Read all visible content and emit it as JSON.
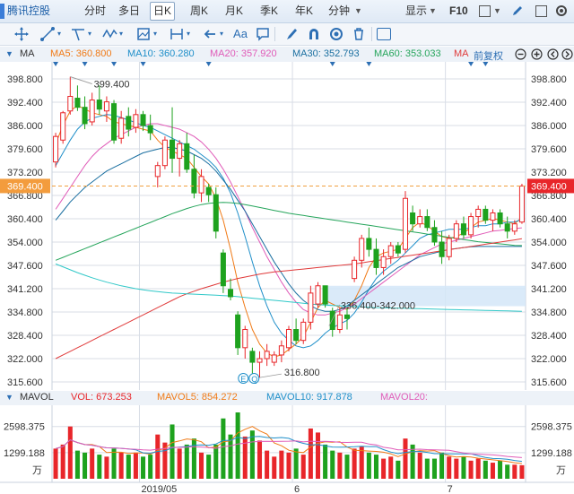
{
  "toolbar": {
    "stock_name": "腾讯控股",
    "periods": [
      "分时",
      "多日",
      "日K",
      "周K",
      "月K",
      "季K",
      "年K",
      "分钟"
    ],
    "active_period": "日K",
    "display_label": "显示",
    "f10_label": "F10"
  },
  "drawing_tools": {
    "text_tool_label": "Aa"
  },
  "ma_legend": {
    "name": "MA",
    "ma5": "MA5: 360.800",
    "ma10": "MA10: 360.280",
    "ma20": "MA20: 357.920",
    "ma30": "MA30: 352.793",
    "ma60": "MA60: 353.033",
    "ma_more": "MA",
    "adjust_label": "前复权"
  },
  "vol_legend": {
    "name": "MAVOL",
    "vol": "VOL: 673.253",
    "mavol5": "MAVOL5: 854.272",
    "mavol10": "MAVOL10: 917.878",
    "mavol20": "MAVOL20:"
  },
  "colors": {
    "up": "#e8262a",
    "down": "#1ea21e",
    "ma5": "#f07a16",
    "ma10": "#1f8fc9",
    "ma20": "#e05bb8",
    "ma30": "#1a6fa0",
    "ma60": "#25a55b",
    "ma120": "#e03a3a",
    "ma250": "#30c8c8",
    "mavol5": "#f07a16",
    "mavol10": "#1f8fc9",
    "mavol20": "#e05bb8",
    "grid": "#d8dde6",
    "dashed_price": "#f0a040"
  },
  "chart_data": {
    "type": "candlestick",
    "y_ticks": [
      "398.800",
      "392.400",
      "386.000",
      "379.600",
      "373.200",
      "366.800",
      "360.400",
      "354.000",
      "347.600",
      "341.200",
      "334.800",
      "328.400",
      "322.000",
      "315.600"
    ],
    "ylim": [
      315.6,
      398.8
    ],
    "x_labels": [
      "2019/05",
      "6",
      "7"
    ],
    "current_price": "369.400",
    "annotations": {
      "high": "399.400",
      "low": "316.800",
      "gap": "336.400-342.000"
    },
    "gap_zone": [
      336.4,
      342.0
    ],
    "candles": [
      {
        "o": 376.0,
        "h": 384.0,
        "l": 374.5,
        "c": 383.0
      },
      {
        "o": 382.0,
        "h": 390.0,
        "l": 381.0,
        "c": 389.5
      },
      {
        "o": 390.0,
        "h": 399.4,
        "l": 389.0,
        "c": 394.0
      },
      {
        "o": 393.5,
        "h": 397.0,
        "l": 390.0,
        "c": 391.0
      },
      {
        "o": 391.0,
        "h": 394.0,
        "l": 385.0,
        "c": 386.5
      },
      {
        "o": 387.0,
        "h": 395.0,
        "l": 386.0,
        "c": 393.0
      },
      {
        "o": 393.0,
        "h": 397.0,
        "l": 389.0,
        "c": 390.5
      },
      {
        "o": 390.0,
        "h": 394.0,
        "l": 387.0,
        "c": 392.5
      },
      {
        "o": 392.0,
        "h": 393.0,
        "l": 381.0,
        "c": 382.0
      },
      {
        "o": 382.5,
        "h": 390.0,
        "l": 381.0,
        "c": 388.0
      },
      {
        "o": 388.5,
        "h": 391.0,
        "l": 383.0,
        "c": 385.0
      },
      {
        "o": 385.5,
        "h": 390.5,
        "l": 384.0,
        "c": 389.0
      },
      {
        "o": 389.0,
        "h": 390.0,
        "l": 384.5,
        "c": 386.0
      },
      {
        "o": 386.0,
        "h": 389.0,
        "l": 382.0,
        "c": 384.0
      },
      {
        "o": 372.0,
        "h": 376.0,
        "l": 369.0,
        "c": 375.0
      },
      {
        "o": 375.0,
        "h": 383.0,
        "l": 374.0,
        "c": 382.0
      },
      {
        "o": 382.0,
        "h": 391.0,
        "l": 373.0,
        "c": 377.0
      },
      {
        "o": 377.0,
        "h": 382.0,
        "l": 372.0,
        "c": 381.0
      },
      {
        "o": 381.0,
        "h": 384.0,
        "l": 373.0,
        "c": 374.0
      },
      {
        "o": 374.0,
        "h": 378.0,
        "l": 366.0,
        "c": 367.5
      },
      {
        "o": 367.5,
        "h": 374.0,
        "l": 365.0,
        "c": 372.0
      },
      {
        "o": 369.0,
        "h": 370.0,
        "l": 365.0,
        "c": 367.0
      },
      {
        "o": 367.0,
        "h": 369.0,
        "l": 355.0,
        "c": 357.0
      },
      {
        "o": 351.0,
        "h": 352.0,
        "l": 340.0,
        "c": 342.0
      },
      {
        "o": 341.0,
        "h": 344.0,
        "l": 338.0,
        "c": 339.0
      },
      {
        "o": 334.0,
        "h": 335.0,
        "l": 323.0,
        "c": 325.0
      },
      {
        "o": 325.0,
        "h": 331.0,
        "l": 322.0,
        "c": 330.0
      },
      {
        "o": 324.0,
        "h": 325.0,
        "l": 317.0,
        "c": 321.0
      },
      {
        "o": 321.0,
        "h": 324.0,
        "l": 316.8,
        "c": 322.0
      },
      {
        "o": 322.0,
        "h": 326.0,
        "l": 320.0,
        "c": 324.0
      },
      {
        "o": 321.0,
        "h": 324.0,
        "l": 320.0,
        "c": 323.0
      },
      {
        "o": 323.0,
        "h": 327.0,
        "l": 321.0,
        "c": 325.5
      },
      {
        "o": 325.0,
        "h": 331.0,
        "l": 324.0,
        "c": 330.0
      },
      {
        "o": 330.0,
        "h": 333.0,
        "l": 326.0,
        "c": 327.0
      },
      {
        "o": 327.0,
        "h": 333.0,
        "l": 326.0,
        "c": 332.0
      },
      {
        "o": 332.0,
        "h": 342.0,
        "l": 330.0,
        "c": 340.0
      },
      {
        "o": 337.0,
        "h": 343.0,
        "l": 336.0,
        "c": 342.0
      },
      {
        "o": 342.0,
        "h": 342.0,
        "l": 336.0,
        "c": 337.0
      },
      {
        "o": 335.0,
        "h": 336.0,
        "l": 328.0,
        "c": 330.0
      },
      {
        "o": 330.0,
        "h": 336.0,
        "l": 329.0,
        "c": 334.0
      },
      {
        "o": 334.0,
        "h": 336.0,
        "l": 330.0,
        "c": 333.0
      },
      {
        "o": 344.0,
        "h": 350.0,
        "l": 343.0,
        "c": 349.0
      },
      {
        "o": 349.0,
        "h": 356.0,
        "l": 347.0,
        "c": 355.0
      },
      {
        "o": 355.0,
        "h": 358.0,
        "l": 350.0,
        "c": 352.0
      },
      {
        "o": 352.0,
        "h": 355.0,
        "l": 345.0,
        "c": 347.0
      },
      {
        "o": 347.0,
        "h": 352.0,
        "l": 345.0,
        "c": 350.0
      },
      {
        "o": 350.0,
        "h": 354.0,
        "l": 348.0,
        "c": 353.0
      },
      {
        "o": 353.0,
        "h": 354.0,
        "l": 350.0,
        "c": 351.0
      },
      {
        "o": 352.0,
        "h": 368.0,
        "l": 351.0,
        "c": 366.0
      },
      {
        "o": 362.0,
        "h": 364.0,
        "l": 357.0,
        "c": 359.0
      },
      {
        "o": 359.0,
        "h": 363.0,
        "l": 358.0,
        "c": 361.0
      },
      {
        "o": 361.0,
        "h": 363.0,
        "l": 357.0,
        "c": 358.0
      },
      {
        "o": 358.0,
        "h": 360.0,
        "l": 353.0,
        "c": 354.0
      },
      {
        "o": 354.0,
        "h": 357.0,
        "l": 348.0,
        "c": 350.0
      },
      {
        "o": 350.0,
        "h": 356.0,
        "l": 349.0,
        "c": 355.0
      },
      {
        "o": 355.0,
        "h": 360.0,
        "l": 354.0,
        "c": 359.0
      },
      {
        "o": 359.0,
        "h": 361.0,
        "l": 355.0,
        "c": 356.0
      },
      {
        "o": 356.0,
        "h": 362.0,
        "l": 355.0,
        "c": 361.0
      },
      {
        "o": 361.0,
        "h": 364.0,
        "l": 358.0,
        "c": 363.0
      },
      {
        "o": 363.0,
        "h": 364.0,
        "l": 359.0,
        "c": 360.0
      },
      {
        "o": 360.0,
        "h": 363.0,
        "l": 357.0,
        "c": 362.0
      },
      {
        "o": 362.0,
        "h": 363.0,
        "l": 358.0,
        "c": 359.0
      },
      {
        "o": 359.0,
        "h": 361.0,
        "l": 355.0,
        "c": 357.0
      },
      {
        "o": 357.0,
        "h": 360.0,
        "l": 356.0,
        "c": 359.0
      },
      {
        "o": 359.5,
        "h": 370.0,
        "l": 359.0,
        "c": 369.4
      }
    ],
    "ma_lines": {
      "ma5": [
        381.0,
        386.0,
        390.0,
        391.5,
        390.5,
        389.5,
        389.0,
        388.5,
        387.0,
        386.5,
        386.0,
        385.5,
        385.0,
        384.5,
        382.0,
        380.0,
        379.0,
        378.0,
        377.0,
        374.5,
        372.0,
        370.0,
        366.0,
        360.0,
        352.0,
        343.0,
        336.0,
        330.0,
        326.0,
        323.5,
        322.5,
        323.0,
        324.5,
        326.0,
        328.0,
        332.0,
        336.0,
        338.0,
        337.0,
        336.0,
        335.5,
        338.0,
        342.0,
        347.0,
        350.0,
        351.0,
        351.5,
        352.0,
        355.0,
        358.0,
        359.5,
        358.5,
        357.0,
        355.5,
        355.0,
        355.5,
        356.5,
        358.0,
        359.5,
        360.0,
        360.5,
        360.0,
        359.5,
        359.0,
        360.8
      ],
      "ma10": [
        375.0,
        378.5,
        382.0,
        385.0,
        387.0,
        388.0,
        388.5,
        389.0,
        388.8,
        388.2,
        387.5,
        386.8,
        386.0,
        385.5,
        384.5,
        383.5,
        382.5,
        381.5,
        380.5,
        379.5,
        378.0,
        376.5,
        374.5,
        371.5,
        367.5,
        362.0,
        355.5,
        348.5,
        342.0,
        336.5,
        332.0,
        329.0,
        327.0,
        325.5,
        325.0,
        325.5,
        327.0,
        329.0,
        330.5,
        331.5,
        332.5,
        334.5,
        337.5,
        341.0,
        344.0,
        346.0,
        347.5,
        349.0,
        351.0,
        353.0,
        355.0,
        356.0,
        356.5,
        357.0,
        357.5,
        357.5,
        357.5,
        358.0,
        358.5,
        358.5,
        359.0,
        359.0,
        359.5,
        359.5,
        360.28
      ],
      "ma20": [
        363.0,
        366.0,
        369.0,
        372.0,
        375.0,
        377.5,
        379.5,
        381.0,
        382.5,
        383.5,
        384.5,
        385.5,
        386.0,
        386.5,
        386.5,
        386.0,
        385.5,
        385.0,
        384.0,
        383.0,
        381.5,
        379.5,
        377.0,
        374.0,
        370.5,
        366.5,
        362.5,
        358.0,
        354.0,
        350.0,
        346.5,
        343.0,
        340.0,
        337.5,
        335.5,
        334.5,
        334.0,
        334.0,
        334.5,
        335.0,
        336.0,
        337.0,
        338.5,
        340.0,
        341.5,
        343.0,
        344.5,
        346.0,
        347.5,
        349.0,
        350.5,
        351.5,
        352.5,
        353.5,
        354.0,
        354.5,
        355.0,
        355.5,
        356.0,
        356.5,
        357.0,
        357.2,
        357.5,
        357.7,
        357.92
      ],
      "ma30": [
        360.0,
        362.5,
        365.0,
        367.0,
        369.0,
        370.5,
        372.0,
        373.5,
        374.5,
        375.5,
        376.5,
        377.5,
        378.5,
        379.0,
        379.5,
        380.0,
        380.0,
        379.5,
        379.0,
        378.0,
        377.0,
        375.5,
        373.5,
        371.0,
        368.5,
        365.5,
        362.5,
        359.0,
        355.5,
        352.0,
        348.5,
        345.5,
        342.5,
        340.0,
        338.0,
        336.5,
        335.5,
        335.0,
        335.0,
        335.5,
        336.5,
        338.0,
        339.5,
        341.0,
        342.5,
        344.0,
        345.5,
        347.0,
        348.0,
        349.0,
        350.0,
        350.5,
        351.0,
        351.5,
        352.0,
        352.2,
        352.5,
        352.7,
        352.8,
        352.8,
        352.8,
        352.8,
        352.8,
        352.8,
        352.793
      ],
      "ma60": [
        349.0,
        349.8,
        350.6,
        351.4,
        352.2,
        353.0,
        353.8,
        354.6,
        355.4,
        356.2,
        357.0,
        357.8,
        358.6,
        359.4,
        360.2,
        361.0,
        361.8,
        362.5,
        363.2,
        363.8,
        364.3,
        364.6,
        364.8,
        364.9,
        364.8,
        364.6,
        364.3,
        363.9,
        363.5,
        363.1,
        362.7,
        362.3,
        361.9,
        361.6,
        361.3,
        361.0,
        360.7,
        360.4,
        360.1,
        359.8,
        359.5,
        359.2,
        358.9,
        358.6,
        358.3,
        358.0,
        357.7,
        357.4,
        357.1,
        356.8,
        356.5,
        356.2,
        355.9,
        355.6,
        355.3,
        355.0,
        354.7,
        354.4,
        354.1,
        353.9,
        353.7,
        353.5,
        353.3,
        353.1,
        353.033
      ],
      "ma120": [
        322.0,
        323.0,
        324.0,
        325.0,
        326.0,
        327.0,
        328.0,
        329.0,
        330.0,
        331.0,
        332.0,
        333.0,
        334.0,
        335.0,
        336.0,
        337.0,
        338.0,
        339.0,
        339.8,
        340.5,
        341.2,
        341.8,
        342.4,
        343.0,
        343.5,
        344.0,
        344.4,
        344.8,
        345.2,
        345.5,
        345.8,
        346.0,
        346.2,
        346.4,
        346.6,
        346.8,
        347.0,
        347.2,
        347.4,
        347.6,
        347.8,
        348.0,
        348.3,
        348.6,
        348.9,
        349.2,
        349.5,
        349.8,
        350.1,
        350.4,
        350.7,
        351.0,
        351.3,
        351.6,
        351.9,
        352.2,
        352.5,
        352.8,
        353.1,
        353.4,
        353.7,
        354.0,
        354.3,
        354.6,
        354.9
      ],
      "ma250": [
        348.0,
        347.2,
        346.4,
        345.6,
        344.9,
        344.2,
        343.6,
        343.0,
        342.5,
        342.0,
        341.6,
        341.2,
        340.9,
        340.6,
        340.4,
        340.2,
        340.0,
        339.9,
        339.8,
        339.7,
        339.6,
        339.5,
        339.4,
        339.3,
        339.2,
        339.0,
        338.8,
        338.6,
        338.4,
        338.2,
        338.0,
        337.8,
        337.6,
        337.4,
        337.2,
        337.0,
        336.8,
        336.7,
        336.6,
        336.5,
        336.4,
        336.3,
        336.2,
        336.1,
        336.0,
        335.95,
        335.9,
        335.85,
        335.8,
        335.75,
        335.7,
        335.65,
        335.6,
        335.55,
        335.5,
        335.45,
        335.4,
        335.35,
        335.3,
        335.25,
        335.2,
        335.15,
        335.1,
        335.05,
        335.0
      ]
    },
    "volume": {
      "y_ticks": [
        "2598.375",
        "1299.188"
      ],
      "ylim": [
        0,
        3300
      ],
      "unit": "万",
      "bars": [
        1500,
        1700,
        2600,
        1400,
        1300,
        1500,
        1200,
        1100,
        1500,
        1300,
        1200,
        1300,
        1100,
        1200,
        2200,
        1800,
        2700,
        1500,
        1700,
        2000,
        1300,
        1200,
        1700,
        3000,
        2200,
        3300,
        2100,
        2400,
        1900,
        1400,
        1100,
        1400,
        1300,
        1500,
        1200,
        2500,
        2300,
        1700,
        1400,
        1300,
        1200,
        1500,
        1600,
        1300,
        1200,
        1000,
        1100,
        900,
        2000,
        1700,
        1300,
        1000,
        1000,
        1300,
        1100,
        1000,
        1100,
        900,
        1000,
        900,
        800,
        900,
        700,
        700,
        673
      ]
    }
  }
}
